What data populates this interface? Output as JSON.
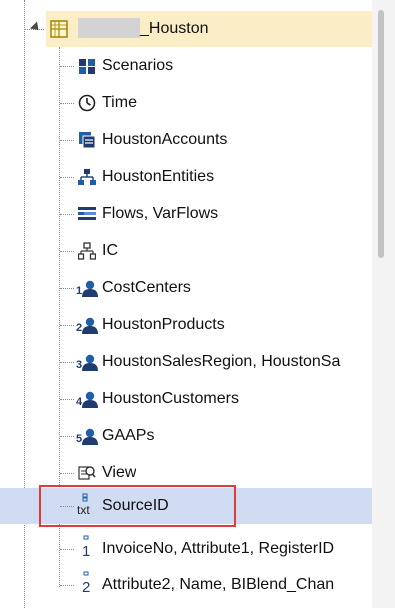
{
  "tree": {
    "root_label": "_Houston",
    "items": [
      {
        "label": "Scenarios",
        "icon": "scenarios-icon"
      },
      {
        "label": "Time",
        "icon": "clock-icon"
      },
      {
        "label": "HoustonAccounts",
        "icon": "accounts-icon"
      },
      {
        "label": "HoustonEntities",
        "icon": "entities-icon"
      },
      {
        "label": "Flows, VarFlows",
        "icon": "flows-icon"
      },
      {
        "label": "IC",
        "icon": "ic-icon"
      },
      {
        "label": "CostCenters",
        "icon": "user-defined-1-icon",
        "number": "1"
      },
      {
        "label": "HoustonProducts",
        "icon": "user-defined-2-icon",
        "number": "2"
      },
      {
        "label": "HoustonSalesRegion, HoustonSa",
        "icon": "user-defined-3-icon",
        "number": "3"
      },
      {
        "label": "HoustonCustomers",
        "icon": "user-defined-4-icon",
        "number": "4"
      },
      {
        "label": "GAAPs",
        "icon": "user-defined-5-icon",
        "number": "5"
      },
      {
        "label": "View",
        "icon": "view-icon"
      }
    ],
    "selected_item": {
      "label": "SourceID",
      "icon": "text-attribute-icon",
      "icon_text": "txt"
    },
    "attribute_items": [
      {
        "label": "InvoiceNo, Attribute1, RegisterID",
        "icon": "attribute-1-icon",
        "number": "1"
      },
      {
        "label": "Attribute2, Name, BIBlend_Chan",
        "icon": "attribute-2-icon",
        "number": "2"
      }
    ]
  },
  "colors": {
    "root_highlight": "#fbeec7",
    "selected_row": "#cfdcf1",
    "annotation_box": "#e03a3a",
    "icon_blue": "#1f5fa8",
    "icon_dark": "#1f3b70"
  }
}
